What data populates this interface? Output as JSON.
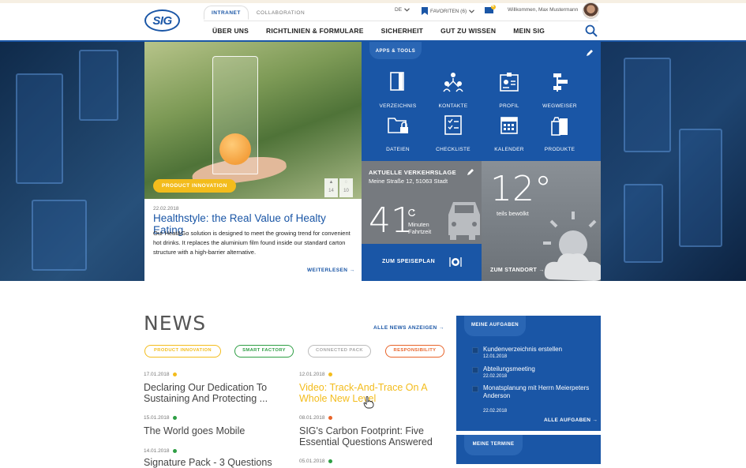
{
  "header": {
    "logo": "SIG",
    "tabs": [
      {
        "label": "INTRANET",
        "active": true
      },
      {
        "label": "COLLABORATION",
        "active": false
      }
    ],
    "language": "DE",
    "favorites": "FAVORITEN (6)",
    "notification_count": "4",
    "welcome": "Willkommen, Max Mustermann",
    "nav": [
      "ÜBER UNS",
      "RICHTLINIEN & FORMULARE",
      "SICHERHEIT",
      "GUT ZU WISSEN",
      "MEIN SIG"
    ]
  },
  "feature": {
    "badge": "PRODUCT INNOVATION",
    "likes": "14",
    "comments": "10",
    "date": "22.02.2018",
    "title": "Healthstyle: the Real Value of Healty Eating",
    "text": "Our Heat&Go solution is designed to meet the growing trend for convenient hot drinks. It replaces the aluminium film found inside our standard carton structure with a high-barrier alternative.",
    "more": "WEITERLESEN"
  },
  "apps": {
    "title": "APPS & TOOLS",
    "items": [
      {
        "label": "VERZEICHNIS",
        "icon": "book-icon"
      },
      {
        "label": "KONTAKTE",
        "icon": "contacts-icon"
      },
      {
        "label": "PROFIL",
        "icon": "profile-icon"
      },
      {
        "label": "WEGWEISER",
        "icon": "signpost-icon"
      },
      {
        "label": "DATEIEN",
        "icon": "folder-lock-icon"
      },
      {
        "label": "CHECKLISTE",
        "icon": "checklist-icon"
      },
      {
        "label": "KALENDER",
        "icon": "calendar-icon"
      },
      {
        "label": "PRODUKTE",
        "icon": "products-icon"
      }
    ]
  },
  "traffic": {
    "title": "AKTUELLE VERKEHRSLAGE",
    "address": "Meine Straße 12, 51063 Stadt",
    "minutes": "41",
    "unit_line1": "Minuten",
    "unit_line2": "Fahrtzeit"
  },
  "canteen": {
    "label": "ZUM SPEISEPLAN"
  },
  "weather": {
    "temp": "12°",
    "condition": "teils bewölkt",
    "location_link": "ZUM STANDORT"
  },
  "news": {
    "title": "NEWS",
    "all_link": "ALLE NEWS ANZEIGEN",
    "filters": [
      {
        "label": "PRODUCT INNOVATION",
        "color": "#f3bc1c"
      },
      {
        "label": "SMART FACTORY",
        "color": "#2e9e44"
      },
      {
        "label": "CONNECTED PACK",
        "color": "#bbbbbb"
      },
      {
        "label": "RESPONSIBILITY",
        "color": "#e8642a"
      }
    ],
    "items": [
      {
        "date": "17.01.2018",
        "dot": "#f3bc1c",
        "title": "Declaring Our Dedication To Sustaining And Protecting ..."
      },
      {
        "date": "12.01.2018",
        "dot": "#f3bc1c",
        "title": "Video: Track-And-Trace On A Whole New Level",
        "highlight": "#f3bc1c"
      },
      {
        "date": "15.01.2018",
        "dot": "#2e9e44",
        "title": "The World goes Mobile"
      },
      {
        "date": "08.01.2018",
        "dot": "#e8642a",
        "title": "SIG's Carbon Footprint: Five Essential Questions Answered"
      },
      {
        "date": "14.01.2018",
        "dot": "#2e9e44",
        "title": "Signature Pack - 3 Questions"
      },
      {
        "date": "05.01.2018",
        "dot": "#2e9e44",
        "title": ""
      }
    ]
  },
  "tasks": {
    "title": "MEINE AUFGABEN",
    "items": [
      {
        "title": "Kundenverzeichnis erstellen",
        "date": "12.01.2018"
      },
      {
        "title": "Abteilungsmeeting",
        "date": "22.02.2018"
      },
      {
        "title": "Monatsplanung mit Herrn Meierpeters Anderson",
        "date": "22.02.2018"
      }
    ],
    "all_link": "ALLE AUFGABEN"
  },
  "appointments": {
    "title": "MEINE TERMINE"
  }
}
